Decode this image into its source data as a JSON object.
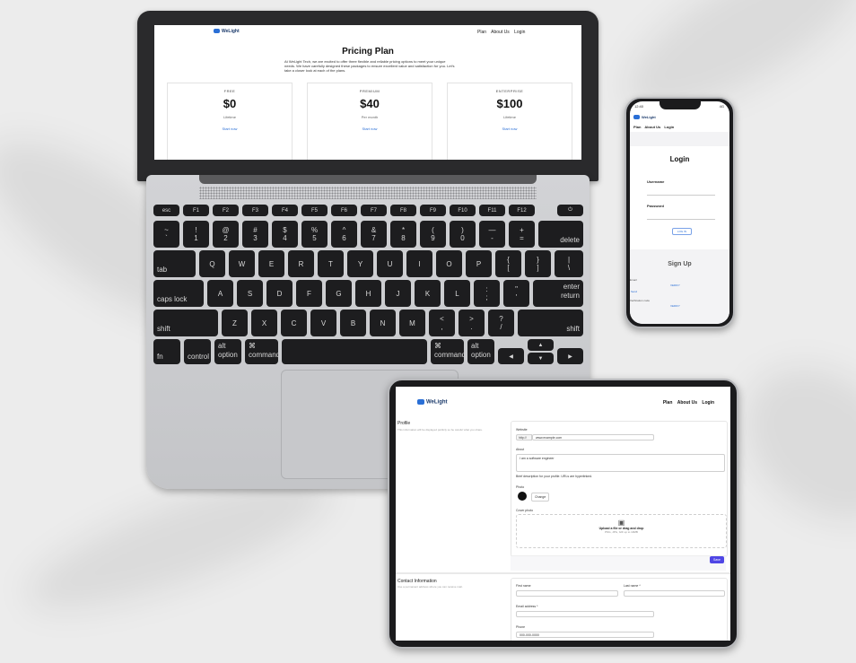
{
  "laptop": {
    "brand": "WeLight",
    "nav": [
      "Plan",
      "About Us",
      "Login"
    ],
    "title": "Pricing Plan",
    "intro": "At WeLight Tech, we are excited to offer three flexible and reliable pricing options to meet your unique needs. We have carefully designed these packages to ensure excellent value and satisfaction for you. Let's take a closer look at each of the plans.",
    "plans": [
      {
        "name": "FREE",
        "price": "$0",
        "period": "Lifetime",
        "cta": "Start now"
      },
      {
        "name": "PREMIUM",
        "price": "$40",
        "period": "Per month",
        "cta": "Start now"
      },
      {
        "name": "ENTERPRISE",
        "price": "$100",
        "period": "Lifetime",
        "cta": "Start now"
      }
    ],
    "keyboard": {
      "fn_row": [
        "esc",
        "F1",
        "F2",
        "F3",
        "F4",
        "F5",
        "F6",
        "F7",
        "F8",
        "F9",
        "F10",
        "F11",
        "F12",
        "power"
      ],
      "num_row": [
        [
          "~",
          "`"
        ],
        [
          "!",
          "1"
        ],
        [
          "@",
          "2"
        ],
        [
          "#",
          "3"
        ],
        [
          "$",
          "4"
        ],
        [
          "%",
          "5"
        ],
        [
          "^",
          "6"
        ],
        [
          "&",
          "7"
        ],
        [
          "*",
          "8"
        ],
        [
          "(",
          "9"
        ],
        [
          ")",
          "0"
        ],
        [
          "—",
          "-"
        ],
        [
          "+",
          "="
        ]
      ],
      "delete": "delete",
      "tab": "tab",
      "q_row": [
        "Q",
        "W",
        "E",
        "R",
        "T",
        "Y",
        "U",
        "I",
        "O",
        "P"
      ],
      "q_row_extra": [
        [
          "{",
          "["
        ],
        [
          "}",
          "]"
        ],
        [
          "|",
          "\\"
        ]
      ],
      "caps": "caps lock",
      "a_row": [
        "A",
        "S",
        "D",
        "F",
        "G",
        "H",
        "J",
        "K",
        "L"
      ],
      "a_row_extra": [
        [
          ":",
          ";"
        ],
        [
          "\"",
          "'"
        ]
      ],
      "enter": [
        "enter",
        "return"
      ],
      "shift": "shift",
      "z_row": [
        "Z",
        "X",
        "C",
        "V",
        "B",
        "N",
        "M"
      ],
      "z_row_extra": [
        [
          "<",
          ","
        ],
        [
          ">",
          "."
        ],
        [
          "?",
          "/"
        ]
      ],
      "bottom": {
        "fn": "fn",
        "control": "control",
        "alt": "alt",
        "option": "option",
        "cmd": "⌘",
        "command": "command"
      },
      "arrows": [
        "◀",
        "▲",
        "▼",
        "▶"
      ]
    }
  },
  "phone": {
    "time": "12:40",
    "signal": "4G",
    "brand": "WeLight",
    "nav": [
      "Plan",
      "About Us",
      "Login"
    ],
    "login_title": "Login",
    "username_label": "Username",
    "password_label": "Password",
    "login_button": "LOG IN",
    "signup_title": "Sign Up",
    "email_label": "Email",
    "verify_label": "Verification code",
    "send_label": "Send",
    "verify_link": "VERIFY",
    "verify_link2": "VERIFY"
  },
  "tablet": {
    "brand": "WeLight",
    "nav": [
      "Plan",
      "About Us",
      "Login"
    ],
    "profile_title": "Profile",
    "profile_desc": "This information will be displayed publicly so be careful what you share.",
    "website_label": "Website",
    "website_prefix": "http://",
    "website_value": "www.example.com",
    "about_label": "About",
    "about_value": "I am a software engineer",
    "about_hint": "Brief description for your profile. URLs are hyperlinked.",
    "photo_label": "Photo",
    "change_button": "Change",
    "cover_label": "Cover photo",
    "upload_text": "Upload a file or drag and drop",
    "upload_hint": "PNG, JPG, GIF up to 10MB",
    "save_button": "Save",
    "contact_title": "Contact Information",
    "contact_desc": "Use a permanent address where you can receive mail.",
    "first_name_label": "First name",
    "last_name_label": "Last name *",
    "email_label": "Email address *",
    "phone_label": "Phone",
    "phone_value": "000-000-0000"
  }
}
